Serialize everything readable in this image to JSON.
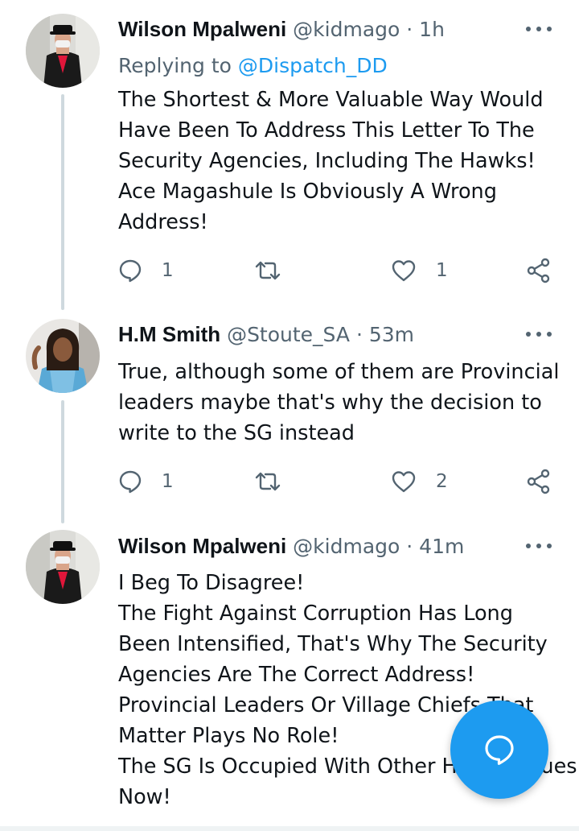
{
  "tweets": [
    {
      "name": "Wilson Mpalweni",
      "handle": "@kidmago",
      "separator": "·",
      "time": "1h",
      "reply_prefix": "Replying to ",
      "reply_to": "@Dispatch_DD",
      "lines": [
        "The Shortest & More Valuable Way Would",
        "Have Been To Address This Letter To The",
        "Security Agencies, Including The Hawks!",
        "Ace Magashule Is Obviously A Wrong",
        "Address!"
      ],
      "replies": "1",
      "retweets": "",
      "likes": "1"
    },
    {
      "name": "H.M Smith",
      "handle": "@Stoute_SA",
      "separator": "·",
      "time": "53m",
      "lines": [
        "True, although some of them are Provincial",
        "leaders maybe that's why the decision to",
        "write to the SG instead"
      ],
      "replies": "1",
      "retweets": "",
      "likes": "2"
    },
    {
      "name": "Wilson Mpalweni",
      "handle": "@kidmago",
      "separator": "·",
      "time": "41m",
      "lines": [
        "I Beg To Disagree!",
        "The Fight Against Corruption Has Long",
        "Been Intensified, That's Why The Security",
        "Agencies Are The Correct Address!",
        "Provincial Leaders Or Village Chiefs That",
        "Matter Plays No Role!",
        "The SG Is Occupied With Other Heavy Issues",
        "Now!"
      ]
    }
  ],
  "colors": {
    "accent": "#1d9bf0",
    "text": "#0f1419",
    "muted": "#536471",
    "thread_line": "#cfd9de"
  },
  "icons": {
    "reply": "reply-bubble-icon",
    "retweet": "retweet-icon",
    "like": "heart-icon",
    "share": "share-icon",
    "more": "more-dots-icon",
    "compose": "compose-reply-icon"
  }
}
